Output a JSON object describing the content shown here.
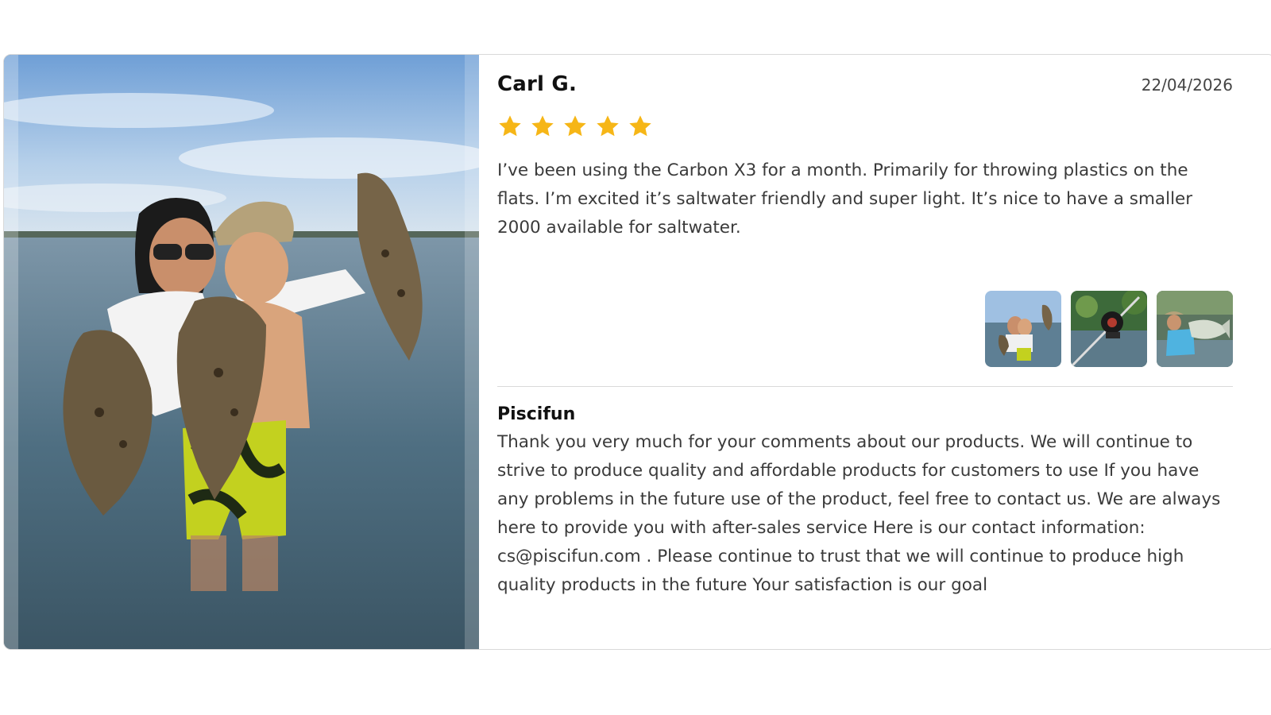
{
  "review": {
    "reviewer_name": "Carl G.",
    "date": "22/04/2026",
    "rating": 5,
    "rating_max": 5,
    "star_color": "#f6b617",
    "text": "I’ve been using the Carbon X3 for a month. Primarily for throwing plastics on the flats. I’m excited it’s saltwater friendly and super light. It’s nice to have a smaller 2000 available for saltwater.",
    "thumbnails": [
      {
        "icon": "family-flounder-photo-thumbnail"
      },
      {
        "icon": "fishing-reel-photo-thumbnail"
      },
      {
        "icon": "angler-fish-catch-photo-thumbnail"
      }
    ]
  },
  "reply": {
    "author": "Piscifun",
    "text": "Thank you very much for your comments about our products. We will continue to strive to produce quality and affordable products for customers to use If you have any problems in the future use of the product, feel free to contact us. We are always here to provide you with after-sales service Here is our contact information: cs@piscifun.com . Please continue to trust that we will continue to produce high quality products in the future Your satisfaction is our goal"
  }
}
